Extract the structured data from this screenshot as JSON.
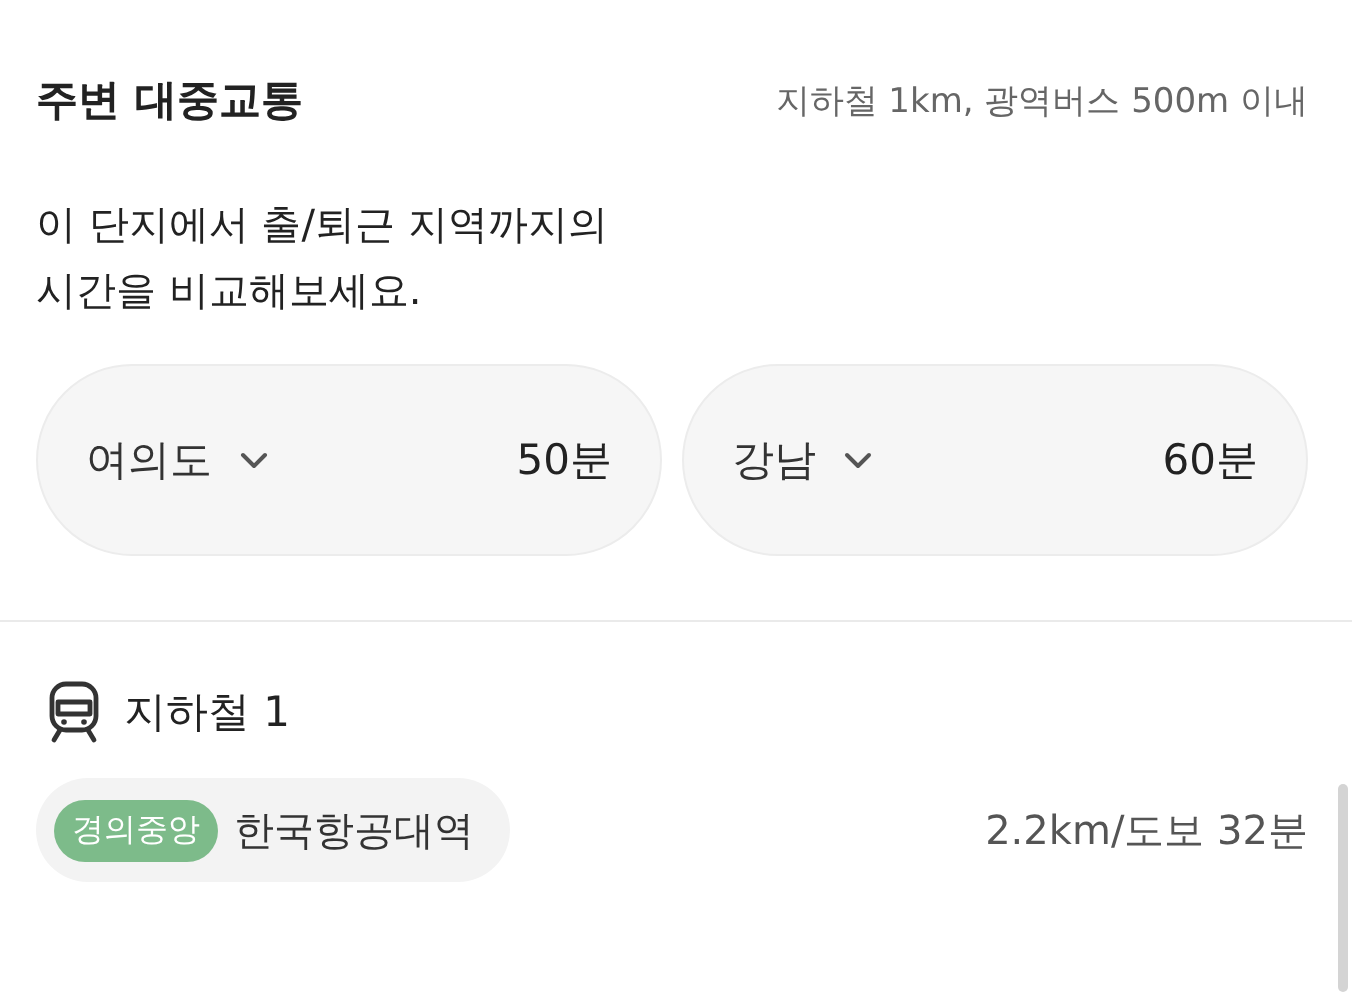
{
  "header": {
    "title": "주변 대중교통",
    "summary": "지하철 1km, 광역버스 500m 이내"
  },
  "description": "이 단지에서 출/퇴근 지역까지의\n시간을 비교해보세요.",
  "destinations": [
    {
      "place": "여의도",
      "time": "50분"
    },
    {
      "place": "강남",
      "time": "60분"
    }
  ],
  "subway": {
    "title": "지하철 1",
    "stations": [
      {
        "line": "경의중앙",
        "color": "#7dbb8a",
        "name": "한국항공대역",
        "distance": "2.2km/도보 32분"
      }
    ]
  }
}
